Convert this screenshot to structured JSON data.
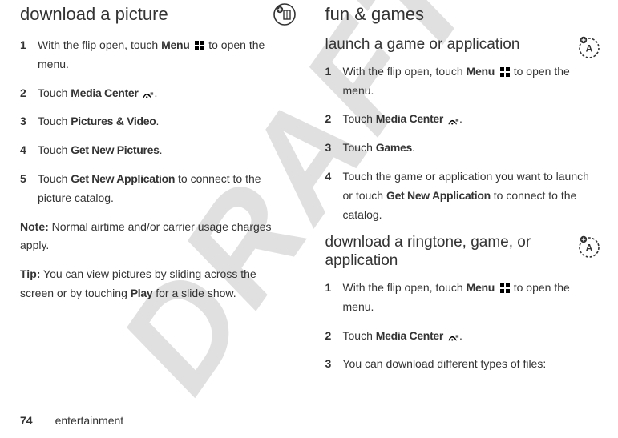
{
  "watermark": "DRAFT",
  "left": {
    "heading": "download a picture",
    "steps": [
      {
        "pre": "With the flip open, touch ",
        "bold": "Menu",
        "icon": "menu",
        "post": " to open the menu."
      },
      {
        "pre": "Touch ",
        "bold": "Media Center",
        "icon": "signal",
        "post": "."
      },
      {
        "pre": "Touch ",
        "bold": "Pictures & Video",
        "post": "."
      },
      {
        "pre": "Touch ",
        "bold": "Get New Pictures",
        "post": "."
      },
      {
        "pre": "Touch ",
        "bold": "Get New Application",
        "post": " to connect to the picture catalog."
      }
    ],
    "note_label": "Note:",
    "note_text": " Normal airtime and/or carrier usage charges apply.",
    "tip_label": "Tip:",
    "tip_text_pre": " You can view pictures by sliding across the screen or by touching ",
    "tip_bold": "Play",
    "tip_text_post": " for a slide show."
  },
  "right": {
    "heading": "fun & games",
    "section1": {
      "heading": "launch a game or application",
      "steps": [
        {
          "pre": "With the flip open, touch ",
          "bold": "Menu",
          "icon": "menu",
          "post": " to open the menu."
        },
        {
          "pre": "Touch ",
          "bold": "Media Center",
          "icon": "signal",
          "post": "."
        },
        {
          "pre": "Touch ",
          "bold": "Games",
          "post": "."
        },
        {
          "pre": "Touch the game or application you want to launch or touch ",
          "bold": "Get New Application",
          "post": " to connect to the catalog."
        }
      ]
    },
    "section2": {
      "heading": "download a ringtone, game, or application",
      "steps": [
        {
          "pre": "With the flip open, touch ",
          "bold": "Menu",
          "icon": "menu",
          "post": " to open the menu."
        },
        {
          "pre": "Touch ",
          "bold": "Media Center",
          "icon": "signal",
          "post": "."
        },
        {
          "pre": "You can download different types of files:"
        }
      ]
    }
  },
  "footer": {
    "page": "74",
    "section": "entertainment"
  }
}
